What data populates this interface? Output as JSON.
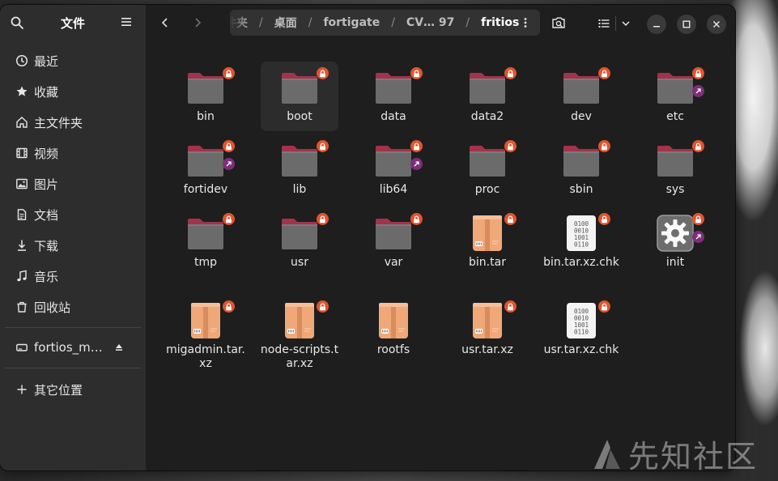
{
  "sidebar": {
    "title": "文件",
    "items": [
      {
        "label": "最近",
        "icon": "clock-icon"
      },
      {
        "label": "收藏",
        "icon": "star-icon"
      },
      {
        "label": "主文件夹",
        "icon": "home-icon"
      },
      {
        "label": "视频",
        "icon": "video-icon"
      },
      {
        "label": "图片",
        "icon": "image-icon"
      },
      {
        "label": "文档",
        "icon": "document-icon"
      },
      {
        "label": "下载",
        "icon": "download-icon"
      },
      {
        "label": "音乐",
        "icon": "music-icon"
      },
      {
        "label": "回收站",
        "icon": "trash-icon"
      }
    ],
    "device": {
      "label": "fortios_m…",
      "icon": "drive-icon"
    },
    "other_locations": {
      "label": "其它位置",
      "icon": "plus-icon"
    }
  },
  "pathbar": {
    "crumbs": [
      "件夹",
      "桌面",
      "fortigate",
      "CV… 97",
      "fritios"
    ]
  },
  "files": [
    {
      "name": "bin",
      "type": "folder",
      "lock": true,
      "link": false
    },
    {
      "name": "boot",
      "type": "folder",
      "lock": true,
      "link": false,
      "selected": true
    },
    {
      "name": "data",
      "type": "folder",
      "lock": true,
      "link": false
    },
    {
      "name": "data2",
      "type": "folder",
      "lock": true,
      "link": false
    },
    {
      "name": "dev",
      "type": "folder",
      "lock": true,
      "link": false
    },
    {
      "name": "etc",
      "type": "folder",
      "lock": true,
      "link": true
    },
    {
      "name": "fortidev",
      "type": "folder",
      "lock": true,
      "link": true
    },
    {
      "name": "lib",
      "type": "folder",
      "lock": true,
      "link": false
    },
    {
      "name": "lib64",
      "type": "folder",
      "lock": true,
      "link": true
    },
    {
      "name": "proc",
      "type": "folder",
      "lock": true,
      "link": false
    },
    {
      "name": "sbin",
      "type": "folder",
      "lock": true,
      "link": false
    },
    {
      "name": "sys",
      "type": "folder",
      "lock": true,
      "link": false
    },
    {
      "name": "tmp",
      "type": "folder",
      "lock": true,
      "link": false
    },
    {
      "name": "usr",
      "type": "folder",
      "lock": true,
      "link": false
    },
    {
      "name": "var",
      "type": "folder",
      "lock": true,
      "link": false
    },
    {
      "name": "bin.tar",
      "type": "archive",
      "lock": true,
      "link": false
    },
    {
      "name": "bin.tar.xz.chk",
      "type": "binary",
      "lock": true,
      "link": false
    },
    {
      "name": "init",
      "type": "executable",
      "lock": true,
      "link": true
    },
    {
      "name": "migadmin.tar.xz",
      "type": "archive",
      "lock": true,
      "link": false
    },
    {
      "name": "node-scripts.tar.xz",
      "type": "archive",
      "lock": true,
      "link": false
    },
    {
      "name": "rootfs",
      "type": "archive",
      "lock": false,
      "link": false
    },
    {
      "name": "usr.tar.xz",
      "type": "archive",
      "lock": true,
      "link": false
    },
    {
      "name": "usr.tar.xz.chk",
      "type": "binary",
      "lock": true,
      "link": false
    }
  ],
  "binary_glyph": [
    "0100",
    "0010",
    "1001",
    "0110"
  ],
  "watermark": "先知社区",
  "colors": {
    "folder_body": "#6b6b6b",
    "folder_tab": "#a3334a",
    "lock_badge": "#e3542c",
    "link_badge": "#7d2e7a",
    "archive": "#f0a878"
  }
}
